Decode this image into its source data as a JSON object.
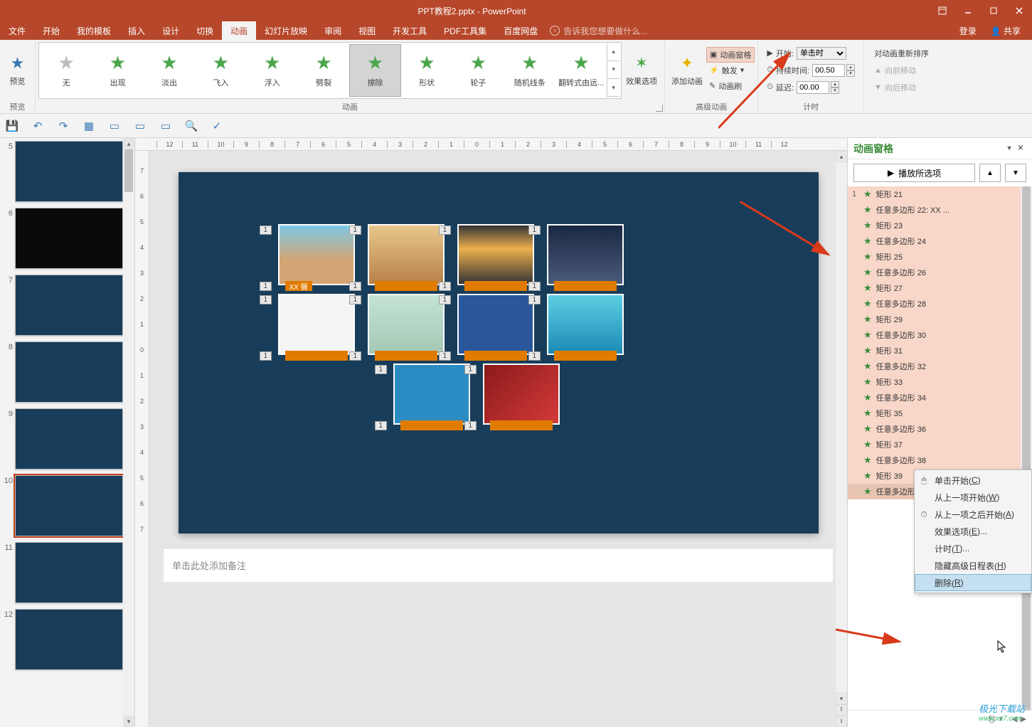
{
  "title": "PPT教程2.pptx - PowerPoint",
  "menubar": {
    "tabs": [
      "文件",
      "开始",
      "我的模板",
      "插入",
      "设计",
      "切换",
      "动画",
      "幻灯片放映",
      "审阅",
      "视图",
      "开发工具",
      "PDF工具集",
      "百度网盘"
    ],
    "active_index": 6,
    "hint": "告诉我您想要做什么...",
    "login": "登录",
    "share": "共享"
  },
  "ribbon": {
    "preview_group": "预览",
    "preview_btn": "预览",
    "animation_group": "动画",
    "anims": [
      {
        "label": "无",
        "color": "#bcbcbc"
      },
      {
        "label": "出现",
        "color": "#4ca64c"
      },
      {
        "label": "淡出",
        "color": "#4ca64c"
      },
      {
        "label": "飞入",
        "color": "#4ca64c"
      },
      {
        "label": "浮入",
        "color": "#4ca64c"
      },
      {
        "label": "劈裂",
        "color": "#4ca64c"
      },
      {
        "label": "擦除",
        "color": "#4ca64c",
        "selected": true
      },
      {
        "label": "形状",
        "color": "#4ca64c"
      },
      {
        "label": "轮子",
        "color": "#4ca64c"
      },
      {
        "label": "随机线条",
        "color": "#4ca64c"
      },
      {
        "label": "翻转式由远...",
        "color": "#4ca64c"
      }
    ],
    "effect_options": "效果选项",
    "add_anim": "添加动画",
    "anim_pane_btn": "动画窗格",
    "trigger": "触发",
    "anim_painter": "动画刷",
    "advanced_group": "高级动画",
    "start_label": "开始:",
    "start_value": "单击时",
    "duration_label": "持续时间:",
    "duration_value": "00.50",
    "delay_label": "延迟:",
    "delay_value": "00.00",
    "timing_group": "计时",
    "reorder_label": "对动画重新排序",
    "move_earlier": "向前移动",
    "move_later": "向后移动"
  },
  "thumbs": [
    5,
    6,
    7,
    8,
    9,
    10,
    11,
    12
  ],
  "selected_thumb": 10,
  "notes_placeholder": "单击此处添加备注",
  "slide": {
    "caption0": "XX 摄",
    "anim_tag": "1"
  },
  "anim_pane": {
    "title": "动画窗格",
    "play": "播放所选项",
    "items": [
      {
        "n": "1",
        "label": "矩形 21"
      },
      {
        "n": "",
        "label": "任意多边形 22: XX ..."
      },
      {
        "n": "",
        "label": "矩形 23"
      },
      {
        "n": "",
        "label": "任意多边形 24"
      },
      {
        "n": "",
        "label": "矩形 25"
      },
      {
        "n": "",
        "label": "任意多边形 26"
      },
      {
        "n": "",
        "label": "矩形 27"
      },
      {
        "n": "",
        "label": "任意多边形 28"
      },
      {
        "n": "",
        "label": "矩形 29"
      },
      {
        "n": "",
        "label": "任意多边形 30"
      },
      {
        "n": "",
        "label": "矩形 31"
      },
      {
        "n": "",
        "label": "任意多边形 32"
      },
      {
        "n": "",
        "label": "矩形 33"
      },
      {
        "n": "",
        "label": "任意多边形 34"
      },
      {
        "n": "",
        "label": "矩形 35"
      },
      {
        "n": "",
        "label": "任意多边形 36"
      },
      {
        "n": "",
        "label": "矩形 37"
      },
      {
        "n": "",
        "label": "任意多边形 38"
      },
      {
        "n": "",
        "label": "矩形 39"
      },
      {
        "n": "",
        "label": "任意多边形 40"
      }
    ],
    "footer_unit": "秒"
  },
  "context_menu": {
    "items": [
      {
        "label": "单击开始(C)",
        "icon": "🖱"
      },
      {
        "label": "从上一项开始(W)",
        "icon": ""
      },
      {
        "label": "从上一项之后开始(A)",
        "icon": "⏱"
      },
      {
        "label": "效果选项(E)...",
        "icon": ""
      },
      {
        "label": "计时(T)...",
        "icon": ""
      },
      {
        "label": "隐藏高级日程表(H)",
        "icon": ""
      },
      {
        "label": "删除(R)",
        "icon": "",
        "hover": true
      }
    ]
  },
  "watermark": {
    "line1": "极光下载站",
    "line2": "www.xz7.com"
  },
  "hruler": [
    "12",
    "11",
    "10",
    "9",
    "8",
    "7",
    "6",
    "5",
    "4",
    "3",
    "2",
    "1",
    "0",
    "1",
    "2",
    "3",
    "4",
    "5",
    "6",
    "7",
    "8",
    "9",
    "10",
    "11",
    "12"
  ],
  "vruler": [
    "7",
    "6",
    "5",
    "4",
    "3",
    "2",
    "1",
    "0",
    "1",
    "2",
    "3",
    "4",
    "5",
    "6",
    "7"
  ]
}
